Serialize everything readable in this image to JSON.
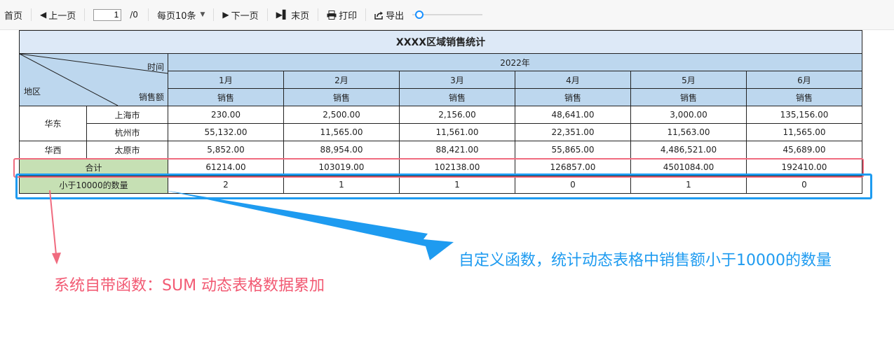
{
  "toolbar": {
    "first": "首页",
    "prev": "上一页",
    "page_value": "1",
    "page_total": "/0",
    "per_page": "每页10条",
    "next": "下一页",
    "last": "末页",
    "print": "打印",
    "export": "导出"
  },
  "report": {
    "title": "XXXX区域销售统计",
    "corner": {
      "time": "时间",
      "region": "地区",
      "sales_amount": "销售额"
    },
    "year": "2022年",
    "months": [
      "1月",
      "2月",
      "3月",
      "4月",
      "5月",
      "6月"
    ],
    "sub_header": "销售",
    "groups": [
      {
        "region": "华东",
        "cities": [
          {
            "city": "上海市",
            "values": [
              "230.00",
              "2,500.00",
              "2,156.00",
              "48,641.00",
              "3,000.00",
              "135,156.00"
            ]
          },
          {
            "city": "杭州市",
            "values": [
              "55,132.00",
              "11,565.00",
              "11,561.00",
              "22,351.00",
              "11,563.00",
              "11,565.00"
            ]
          }
        ]
      },
      {
        "region": "华西",
        "cities": [
          {
            "city": "太原市",
            "values": [
              "5,852.00",
              "88,954.00",
              "88,421.00",
              "55,865.00",
              "4,486,521.00",
              "45,689.00"
            ]
          }
        ]
      }
    ],
    "total": {
      "label": "合计",
      "values": [
        "61214.00",
        "103019.00",
        "102138.00",
        "126857.00",
        "4501084.00",
        "192410.00"
      ]
    },
    "count": {
      "label": "小于10000的数量",
      "values": [
        "2",
        "1",
        "1",
        "0",
        "1",
        "0"
      ]
    }
  },
  "annotations": {
    "blue": "自定义函数，统计动态表格中销售额小于10000的数量",
    "red": "系统自带函数：SUM 动态表格数据累加",
    "blue_color": "#1e9bf0",
    "red_color": "#f25a73"
  }
}
